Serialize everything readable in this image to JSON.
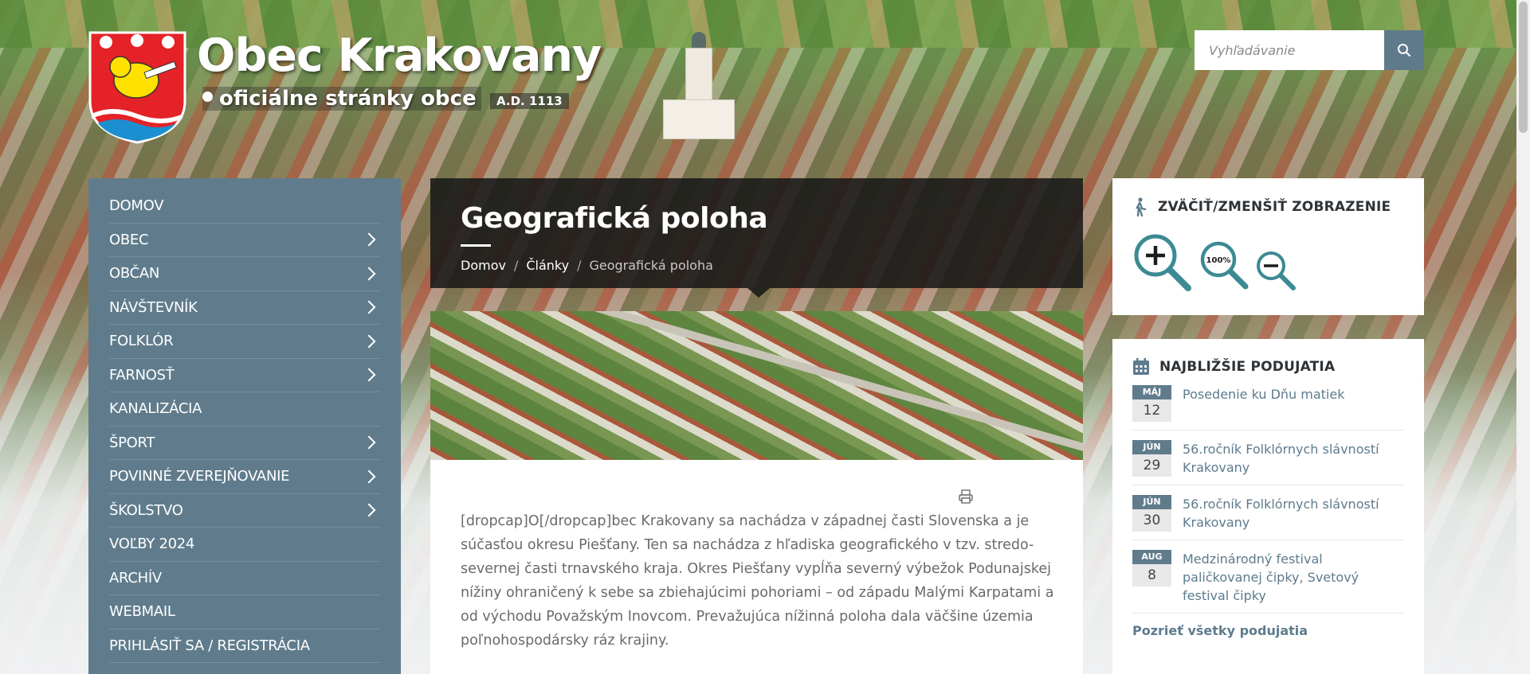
{
  "header": {
    "title": "Obec Krakovany",
    "subtitle": "oficiálne stránky obce",
    "year": "A.D. 1113"
  },
  "search": {
    "placeholder": "Vyhľadávanie",
    "icon": "search-icon"
  },
  "sidebar": {
    "items": [
      {
        "label": "DOMOV",
        "has_submenu": false
      },
      {
        "label": "OBEC",
        "has_submenu": true
      },
      {
        "label": "OBČAN",
        "has_submenu": true
      },
      {
        "label": "NÁVŠTEVNÍK",
        "has_submenu": true
      },
      {
        "label": "FOLKLÓR",
        "has_submenu": true
      },
      {
        "label": "FARNOSŤ",
        "has_submenu": true
      },
      {
        "label": "KANALIZÁCIA",
        "has_submenu": false
      },
      {
        "label": "ŠPORT",
        "has_submenu": true
      },
      {
        "label": "POVINNÉ ZVEREJŇOVANIE",
        "has_submenu": true
      },
      {
        "label": "ŠKOLSTVO",
        "has_submenu": true
      },
      {
        "label": "VOĽBY 2024",
        "has_submenu": false
      },
      {
        "label": "ARCHÍV",
        "has_submenu": false
      },
      {
        "label": "WEBMAIL",
        "has_submenu": false
      },
      {
        "label": "PRIHLÁSIŤ SA / REGISTRÁCIA",
        "has_submenu": false
      }
    ]
  },
  "main": {
    "page_title": "Geografická poloha",
    "breadcrumb": [
      "Domov",
      "Články",
      "Geografická poloha"
    ],
    "breadcrumb_separator": "/",
    "article_text": "[dropcap]O[/dropcap]bec Krakovany sa nachádza v západnej časti Slovenska a je súčasťou okresu Piešťany. Ten sa nachádza z hľadiska geografického v tzv. stredo-severnej časti trnavského kraja. Okres Piešťany vypĺňa severný výbežok Podunajskej nížiny ohraničený k sebe sa zbiehajúcimi pohoriami – od západu Malými Karpatami a od východu Považským Inovcom. Prevažujúca nížinná poloha dala väčšine územia poľnohospodársky ráz krajiny."
  },
  "zoom_widget": {
    "title": "ZVÄČIŤ/ZMENŠIŤ ZOBRAZENIE",
    "reset_label": "100%"
  },
  "events_widget": {
    "title": "NAJBLIŽŠIE PODUJATIA",
    "events": [
      {
        "month": "MÁJ",
        "day": "12",
        "title": "Posedenie ku Dňu matiek"
      },
      {
        "month": "JÚN",
        "day": "29",
        "title": "56.ročník Folklórnych slávností Krakovany"
      },
      {
        "month": "JÚN",
        "day": "30",
        "title": "56.ročník Folklórnych slávností Krakovany"
      },
      {
        "month": "AUG",
        "day": "8",
        "title": "Medzinárodný festival paličkovanej čipky, Svetový festival čipky"
      }
    ],
    "all_link": "Pozrieť všetky podujatia"
  },
  "colors": {
    "accent": "#607c8c",
    "link": "#5d7b8d",
    "zoom_icon": "#3b8a94",
    "title_box": "#191919"
  }
}
